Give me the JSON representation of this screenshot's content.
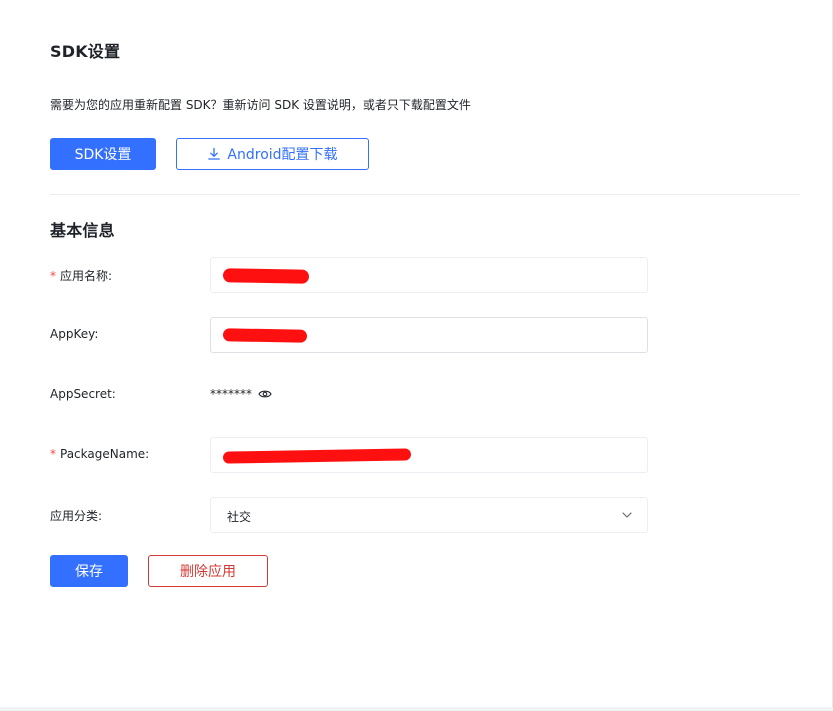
{
  "sdk_section": {
    "title": "SDK设置",
    "hint": "需要为您的应用重新配置 SDK？重新访问 SDK 设置说明，或者只下载配置文件",
    "sdk_button": "SDK设置",
    "android_button": "Android配置下载"
  },
  "basic_section": {
    "title": "基本信息",
    "fields": {
      "app_name": {
        "required_mark": "*",
        "label": "应用名称:"
      },
      "app_key": {
        "label": "AppKey:"
      },
      "app_secret": {
        "label": "AppSecret:",
        "value": "*******"
      },
      "package_name": {
        "required_mark": "*",
        "label": "PackageName:"
      },
      "category": {
        "label": "应用分类:",
        "value": "社交"
      }
    }
  },
  "actions": {
    "save": "保存",
    "delete": "删除应用"
  },
  "colors": {
    "primary": "#3370ff",
    "danger": "#d33a35",
    "required": "#f54a45",
    "redaction": "#ff1010"
  },
  "icons": [
    "download-icon",
    "eye-icon",
    "chevron-down-icon"
  ]
}
